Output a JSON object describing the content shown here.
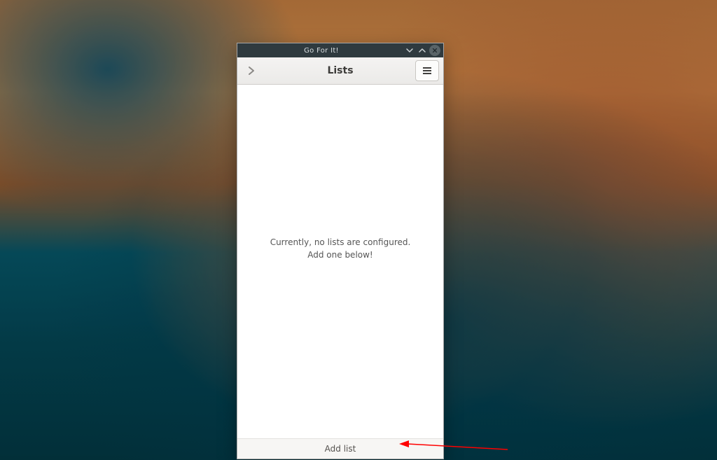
{
  "window": {
    "title": "Go For It!"
  },
  "header": {
    "title": "Lists"
  },
  "content": {
    "empty_message_line1": "Currently, no lists are configured.",
    "empty_message_line2": "Add one below!"
  },
  "footer": {
    "add_list_label": "Add list"
  }
}
